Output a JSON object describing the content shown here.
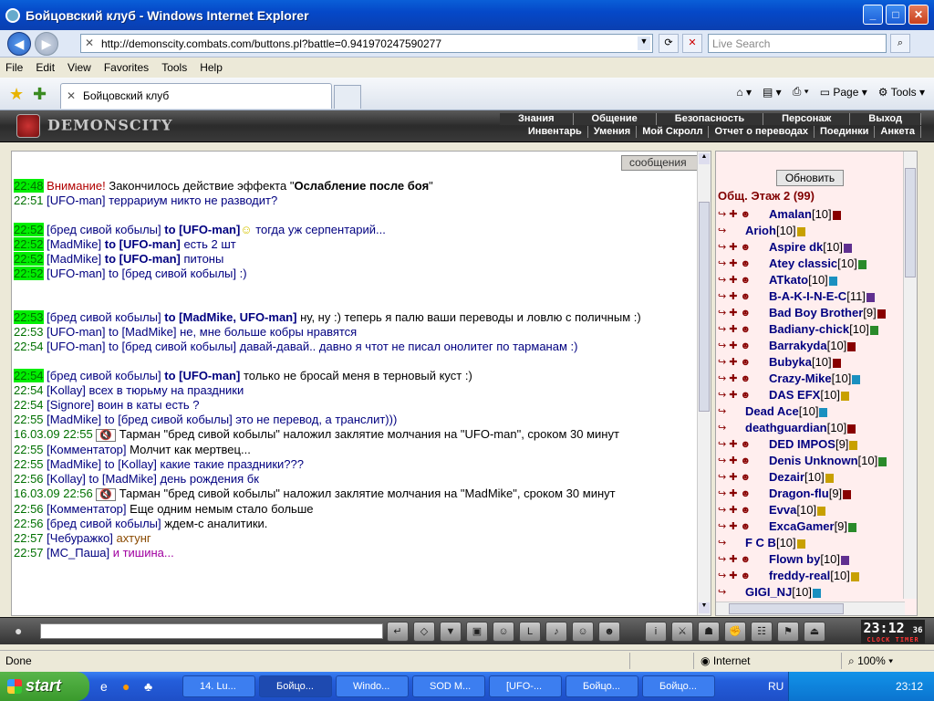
{
  "window": {
    "title": "Бойцовский клуб - Windows Internet Explorer"
  },
  "address": {
    "url": "http://demonscity.combats.com/buttons.pl?battle=0.941970247590277",
    "search_placeholder": "Live Search"
  },
  "menu": [
    "File",
    "Edit",
    "View",
    "Favorites",
    "Tools",
    "Help"
  ],
  "tab": {
    "label": "Бойцовский клуб"
  },
  "commandbar": {
    "page": "Page",
    "tools": "Tools"
  },
  "game": {
    "logo": "DEMONSCITY",
    "nav1": [
      "Знания",
      "Общение",
      "Безопасность",
      "Персонаж",
      "Выход"
    ],
    "nav2": [
      "Инвентарь",
      "Умения",
      "Мой Скролл",
      "Отчет о переводах",
      "Поединки",
      "Анкета"
    ]
  },
  "chat": {
    "tab_label": "сообщения",
    "messages": [
      {
        "time": "22:48",
        "hl": true,
        "type": "sys",
        "warn": "Внимание!",
        "text": " Закончилось действие эффекта \"",
        "bold": "Ослабление после боя",
        "end": "\""
      },
      {
        "time": "22:51",
        "hl": false,
        "nick": "UFO-man",
        "text": " террариум никто не разводит?"
      },
      {
        "gap": true
      },
      {
        "time": "22:52",
        "hl": true,
        "nick": "бред сивой кобылы",
        "to": "to [UFO-man]",
        "text": "  тогда уж серпентарий..."
      },
      {
        "time": "22:52",
        "hl": true,
        "nick": "MadMike",
        "to": "to [UFO-man]",
        "text": " есть 2 шт"
      },
      {
        "time": "22:52",
        "hl": true,
        "nick": "MadMike",
        "to": "to [UFO-man]",
        "text": " питоны"
      },
      {
        "time": "22:52",
        "hl": true,
        "nick": "UFO-man",
        "text": " to [бред сивой кобылы] :)"
      },
      {
        "gap": true
      },
      {
        "gap": true
      },
      {
        "time": "22:53",
        "hl": true,
        "nick": "бред сивой кобылы",
        "to": "to [MadMike, UFO-man]",
        "text": " ну, ну :) теперь я палю ваши переводы и ловлю с поличным :)",
        "black": true
      },
      {
        "time": "22:53",
        "hl": false,
        "nick": "UFO-man",
        "text": " to [MadMike] не, мне больше кобры нравятся"
      },
      {
        "time": "22:54",
        "hl": false,
        "nick": "UFO-man",
        "text": " to [бред сивой кобылы] давай-давай.. давно я чтот не писал онолитег по тарманам :)"
      },
      {
        "gap": true
      },
      {
        "time": "22:54",
        "hl": true,
        "nick": "бред сивой кобылы",
        "to": "to [UFO-man]",
        "text": " только не бросай меня в терновый куст :)",
        "black": true
      },
      {
        "time": "22:54",
        "hl": false,
        "nick": "Kollay",
        "text": " всех в тюрьму на праздники"
      },
      {
        "time": "22:54",
        "hl": false,
        "nick": "Signore",
        "text": " воин в каты есть ?"
      },
      {
        "time": "22:55",
        "hl": false,
        "nick": "MadMike",
        "text": " to [бред сивой кобылы] это не перевод, а транслит)))"
      },
      {
        "time": "16.03.09 22:55",
        "hl": false,
        "type": "sys",
        "text": "  Тарман \"бред сивой кобылы\" наложил заклятие молчания на \"UFO-man\", сроком 30 минут",
        "silence": true
      },
      {
        "time": "22:55",
        "hl": false,
        "nick": "Комментатор",
        "text": " Молчит как мертвец...",
        "black": true
      },
      {
        "time": "22:55",
        "hl": false,
        "nick": "MadMike",
        "text": " to [Kollay] какие такие праздники???"
      },
      {
        "time": "22:56",
        "hl": false,
        "nick": "Kollay",
        "text": " to [MadMike] день рождения бк"
      },
      {
        "time": "16.03.09 22:56",
        "hl": false,
        "type": "sys",
        "text": "  Тарман \"бред сивой кобылы\" наложил заклятие молчания на \"MadMike\", сроком 30 минут",
        "silence": true
      },
      {
        "time": "22:56",
        "hl": false,
        "nick": "Комментатор",
        "text": " Еще одним немым стало больше",
        "black": true
      },
      {
        "time": "22:56",
        "hl": false,
        "nick": "бред сивой кобылы",
        "text": " ждем-с аналитики.",
        "black": true
      },
      {
        "time": "22:57",
        "hl": false,
        "nick": "Чебуражко",
        "text": " ахтунг",
        "brown": true
      },
      {
        "time": "22:57",
        "hl": false,
        "nick": "МС_Паша",
        "text": " и тишина...",
        "purple": true
      }
    ]
  },
  "online": {
    "refresh_label": "Обновить",
    "floor_label": "Общ. Этаж 2 (99)",
    "users": [
      {
        "name": "Amalan",
        "lvl": "[10]",
        "b": "r"
      },
      {
        "name": "Arioh",
        "lvl": "[10]",
        "b": "y",
        "short": true
      },
      {
        "name": "Aspire dk",
        "lvl": "[10]",
        "b": "p"
      },
      {
        "name": "Atey classic",
        "lvl": "[10]",
        "b": "g"
      },
      {
        "name": "ATkato",
        "lvl": "[10]",
        "b": "b"
      },
      {
        "name": "B-A-K-I-N-E-C",
        "lvl": "[11]",
        "b": "p"
      },
      {
        "name": "Bad Boy Brother",
        "lvl": "[9]",
        "b": "r"
      },
      {
        "name": "Badiany-chick",
        "lvl": "[10]",
        "b": "g"
      },
      {
        "name": "Barrakyda",
        "lvl": "[10]",
        "b": "r"
      },
      {
        "name": "Bubyka",
        "lvl": "[10]",
        "b": "r"
      },
      {
        "name": "Crazy-Mike",
        "lvl": "[10]",
        "b": "b"
      },
      {
        "name": "DAS EFX",
        "lvl": "[10]",
        "b": "y"
      },
      {
        "name": "Dead Ace",
        "lvl": "[10]",
        "b": "b",
        "short": true
      },
      {
        "name": "deathguardian",
        "lvl": "[10]",
        "b": "r",
        "short": true
      },
      {
        "name": "DED IMPOS",
        "lvl": "[9]",
        "b": "y"
      },
      {
        "name": "Denis Unknown",
        "lvl": "[10]",
        "b": "g"
      },
      {
        "name": "Dezair",
        "lvl": "[10]",
        "b": "y"
      },
      {
        "name": "Dragon-flu",
        "lvl": "[9]",
        "b": "r"
      },
      {
        "name": "Evva",
        "lvl": "[10]",
        "b": "y"
      },
      {
        "name": "ExcaGamer",
        "lvl": "[9]",
        "b": "g"
      },
      {
        "name": "F C B",
        "lvl": "[10]",
        "b": "y",
        "short": true
      },
      {
        "name": "Flown by",
        "lvl": "[10]",
        "b": "p"
      },
      {
        "name": "freddy-real",
        "lvl": "[10]",
        "b": "y"
      },
      {
        "name": "GIGI_NJ",
        "lvl": "[10]",
        "b": "b",
        "short": true
      }
    ]
  },
  "clock": {
    "time": "23:12",
    "sec": "36",
    "labels": "CLOCK TIMER"
  },
  "status": {
    "left": "Done",
    "zone": "Internet",
    "zoom": "100%"
  },
  "taskbar": {
    "start": "start",
    "tasks": [
      "14. Lu...",
      "Бойцо...",
      "Windo...",
      "SOD M...",
      "[UFO-...",
      "Бойцо...",
      "Бойцо..."
    ],
    "lang": "RU",
    "time": "23:12"
  },
  "colors": {
    "timestamp_highlight": "#00ee00",
    "nick": "#000080",
    "warning": "#b00000",
    "floor": "#800000"
  }
}
